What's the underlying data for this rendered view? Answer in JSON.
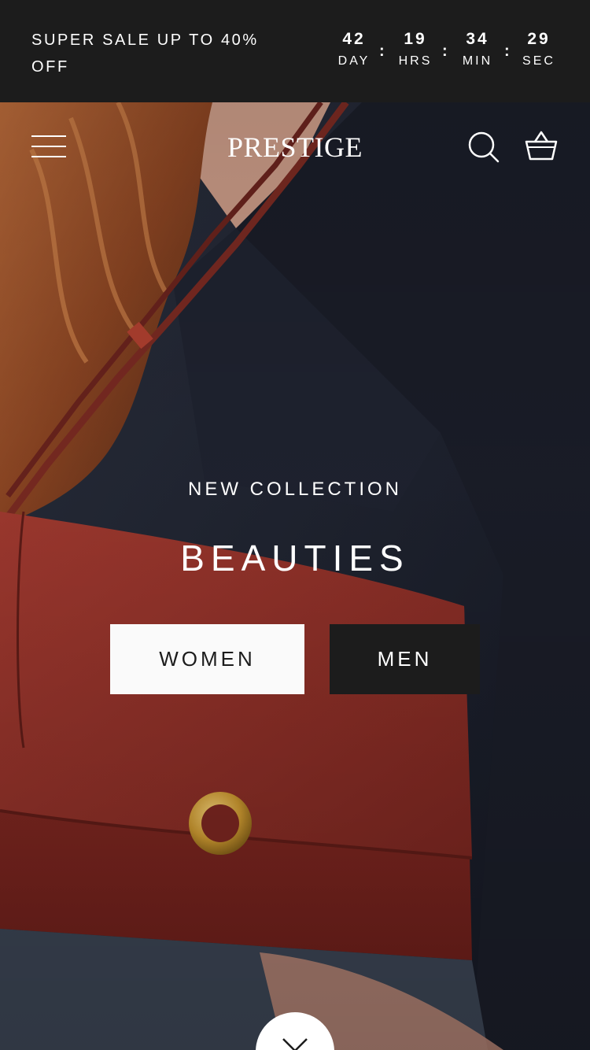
{
  "announcement": {
    "text": "SUPER SALE UP TO 40% OFF",
    "countdown": [
      {
        "value": "42",
        "label": "DAY"
      },
      {
        "value": "19",
        "label": "HRS"
      },
      {
        "value": "34",
        "label": "MIN"
      },
      {
        "value": "29",
        "label": "SEC"
      }
    ],
    "separator": ":"
  },
  "header": {
    "logo": "PRESTIGE",
    "icons": [
      "menu-icon",
      "search-icon",
      "cart-icon"
    ]
  },
  "hero": {
    "subheading": "NEW COLLECTION",
    "title": "BEAUTIES",
    "buttons": [
      {
        "label": "WOMEN"
      },
      {
        "label": "MEN"
      }
    ],
    "scroll_icon": "chevron-down-icon"
  },
  "colors": {
    "bar_bg": "#1c1c1c",
    "text_light": "#ffffff",
    "button_light": "#fafafa",
    "button_dark": "#1c1c1c",
    "bag": "#8e2c24"
  }
}
